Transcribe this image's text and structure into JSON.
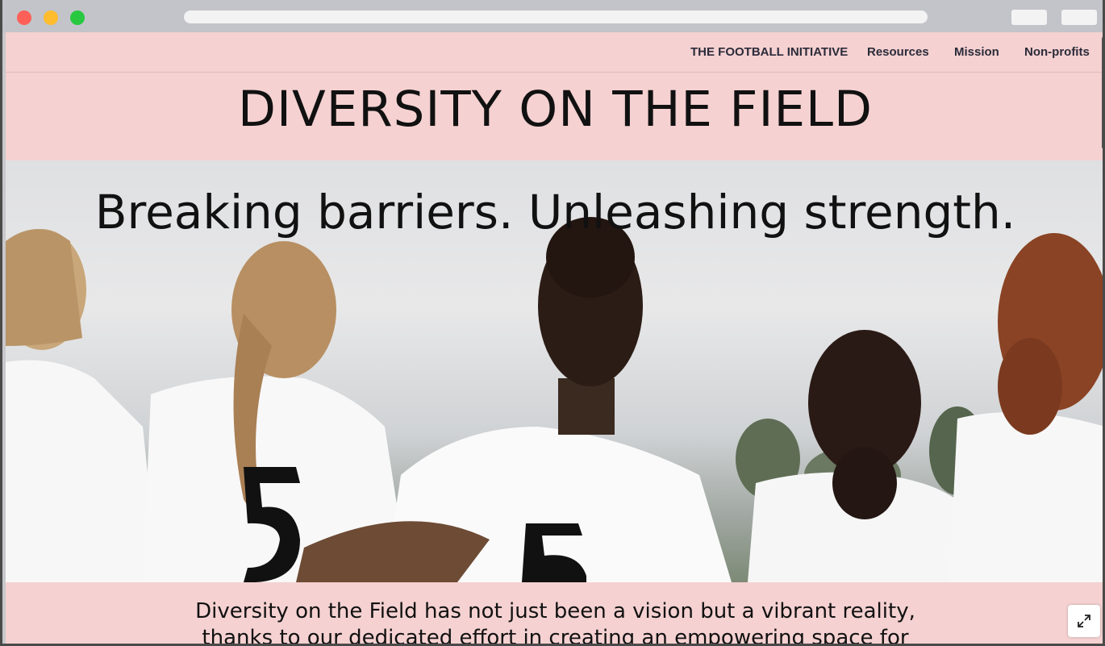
{
  "nav": {
    "brand": "THE FOOTBALL INITIATIVE",
    "items": [
      {
        "label": "Resources"
      },
      {
        "label": "Mission"
      },
      {
        "label": "Non-profits"
      }
    ]
  },
  "hero": {
    "title": "DIVERSITY ON THE FIELD",
    "tagline": "Breaking barriers.  Unleashing strength.",
    "image_description_icon": "team-photo"
  },
  "intro": {
    "line1": "Diversity on the Field has not just been a vision but a vibrant reality,",
    "line2": "thanks to our dedicated effort in creating an empowering space for"
  },
  "controls": {
    "expand_icon": "expand-arrows-icon"
  },
  "colors": {
    "page_bg": "#f5d1d1",
    "titlebar": "#c3c4c9",
    "text": "#111111"
  }
}
